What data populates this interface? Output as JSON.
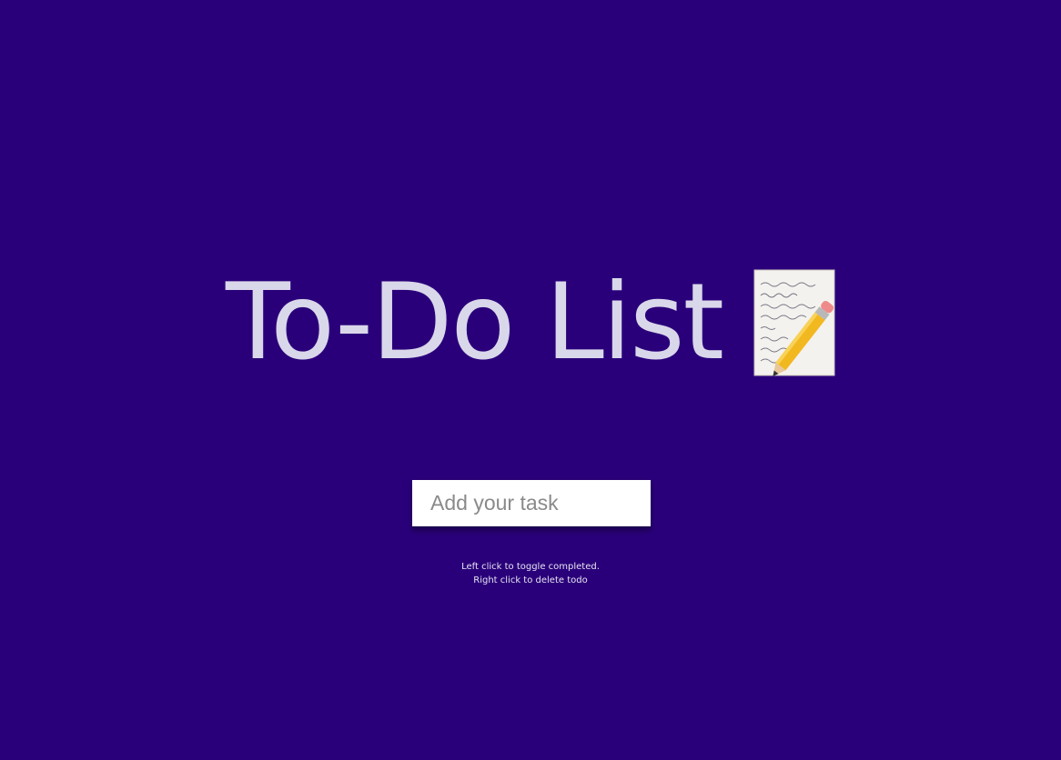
{
  "app": {
    "title": "To-Do List",
    "title_icon": "memo-icon"
  },
  "form": {
    "input_value": "",
    "input_placeholder": "Add your task"
  },
  "todos": [],
  "hints": {
    "line1": "Left click to toggle completed.",
    "line2": "Right click to delete todo"
  },
  "colors": {
    "background": "#2a007a",
    "title_text": "#d9d7ea",
    "input_background": "#ffffff",
    "hint_text": "#e6e4f2"
  }
}
